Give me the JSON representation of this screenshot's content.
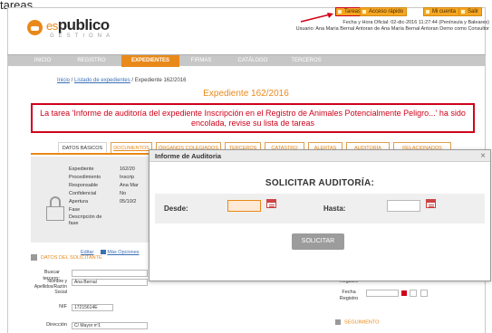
{
  "top_text": "tareas.",
  "logo": {
    "es": "es",
    "name": "publico",
    "sub": "GESTIONA"
  },
  "top_buttons": [
    "Tareas",
    "Acceso rápido",
    "Mi cuenta",
    "Salir"
  ],
  "user_info": {
    "line1": "Fecha y Hora Oficial: 02-dic-2016 11:27:44 (Península y Baleares)",
    "line2": "Usuario: Ana María Bernal Antoran de Ana María Bernal Antoran Demo como Consultor"
  },
  "nav": [
    "INICIO",
    "REGISTRO",
    "EXPEDIENTES",
    "FIRMAS",
    "CATÁLOGO",
    "TERCEROS"
  ],
  "breadcrumb": {
    "inicio": "Inicio",
    "sep1": " / ",
    "listado": "Listado de expedientes",
    "sep2": " / ",
    "current": "Expediente 162/2016"
  },
  "expediente_title": "Expediente 162/2016",
  "message": "La tarea 'Informe de auditoría del expediente Inscripción en el Registro de Animales Potencialmente Peligro...' ha sido encolada, revise su lista de tareas",
  "tabs": [
    "DATOS BÁSICOS",
    "DOCUMENTOS",
    "ÓRGANOS COLEGIADOS",
    "TERCEROS",
    "CATASTRO",
    "ALERTAS",
    "AUDITORÍA",
    "RELACIONADOS"
  ],
  "details": [
    {
      "k": "Expediente",
      "v": "162/20"
    },
    {
      "k": "Procedimiento",
      "v": "Inscrip"
    },
    {
      "k": "Responsable",
      "v": "Ana Mar"
    },
    {
      "k": "Confidencial",
      "v": "No"
    },
    {
      "k": "Apertura",
      "v": "05/10/2"
    },
    {
      "k": "Fase",
      "v": ""
    },
    {
      "k": "Descripción de fase",
      "v": ""
    }
  ],
  "edit_links": {
    "editar": "Editar",
    "mas": "Más Opciones"
  },
  "solicitante": {
    "heading": "DATOS DEL SOLICITANTE",
    "buscar_label": "Buscar tercero:",
    "nombre_label": "Nombre y Apellidos/Razón Social",
    "nombre_value": "Ana Bernal",
    "nif_label": "NIF",
    "nif_value": "17215614E",
    "direccion_label": "Dirección",
    "direccion_value": "C/ Mayor nº1"
  },
  "right_side": {
    "registro_label": "Registro",
    "fecha_label": "Fecha Registro",
    "seguimiento": "SEGUIMIENTO"
  },
  "modal": {
    "title": "Informe de Auditoria",
    "close": "×",
    "heading": "SOLICITAR AUDITORÍA:",
    "desde_label": "Desde:",
    "hasta_label": "Hasta:",
    "button": "SOLICITAR"
  }
}
